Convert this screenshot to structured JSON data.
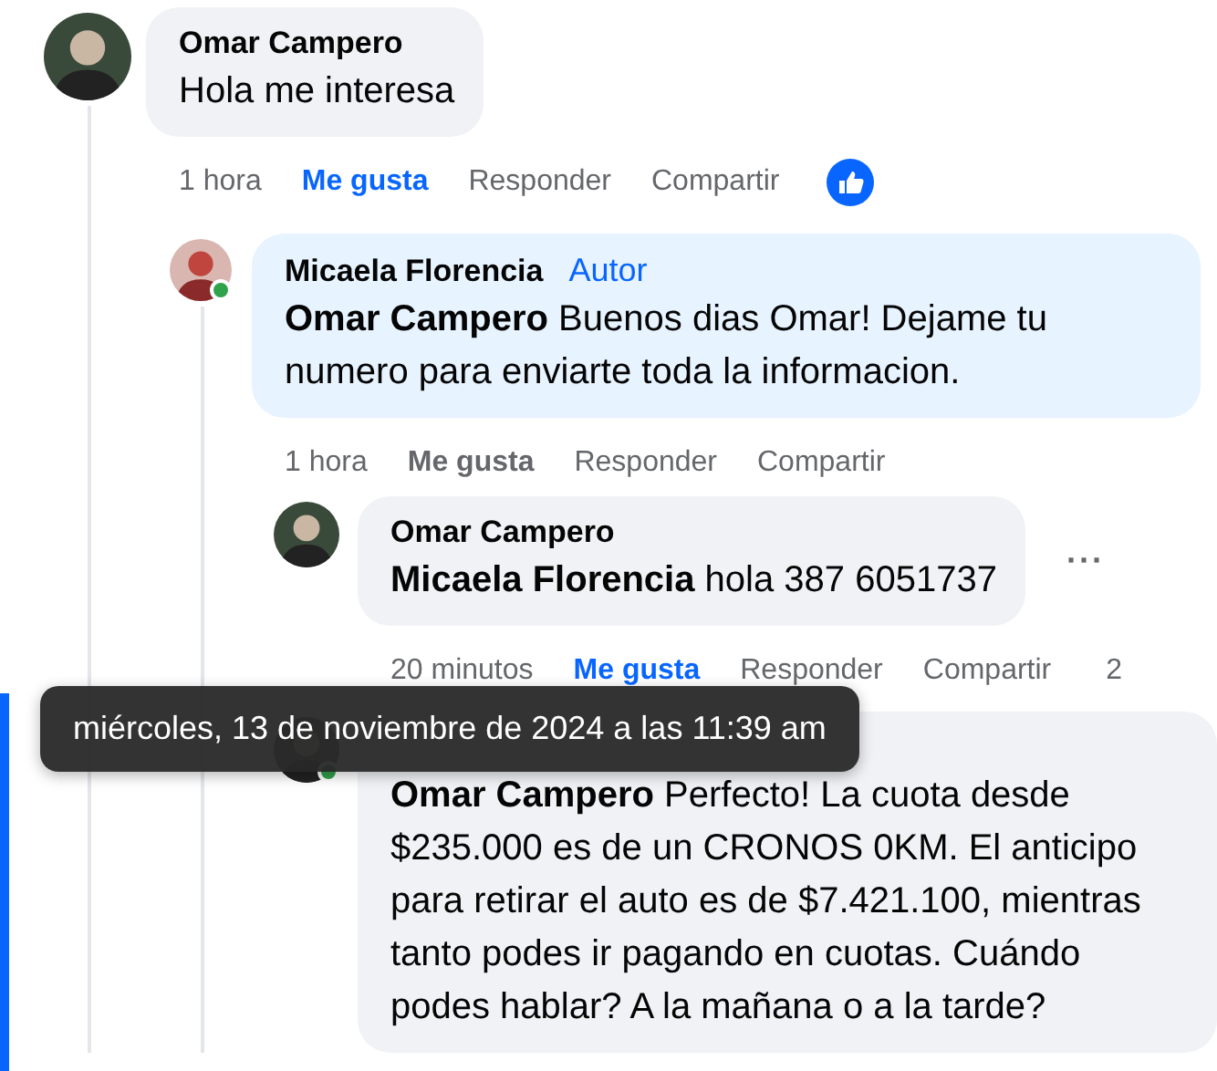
{
  "comments": [
    {
      "author": "Omar Campero",
      "online": false,
      "text": "Hola me interesa",
      "time": "1 hora",
      "like_label": "Me gusta",
      "liked": true,
      "reply_label": "Responder",
      "share_label": "Compartir",
      "reacted": true,
      "children": [
        {
          "author": "Micaela Florencia",
          "badge": "Autor",
          "online": true,
          "mention": "Omar Campero",
          "text": "Buenos dias Omar! Dejame tu numero para enviarte toda la informacion.",
          "time": "1 hora",
          "like_label": "Me gusta",
          "liked": false,
          "reply_label": "Responder",
          "share_label": "Compartir",
          "reacted": false,
          "children": [
            {
              "author": "Omar Campero",
              "online": false,
              "mention": "Micaela Florencia",
              "text": "hola 387 6051737",
              "time": "20 minutos",
              "like_label": "Me gusta",
              "liked": true,
              "reply_label": "Responder",
              "share_label": "Compartir",
              "reacted": false,
              "more_label": "···",
              "reaction_count": "2"
            },
            {
              "online": true,
              "mention": "Omar Campero",
              "text": "Perfecto! La cuota desde $235.000 es de un CRONOS 0KM. El anticipo para retirar el auto es de $7.421.100, mientras tanto podes ir pagando en cuotas. Cuándo podes hablar? A la mañana o a la tarde?"
            }
          ]
        }
      ]
    }
  ],
  "tooltip": "miércoles, 13 de noviembre de 2024 a las 11:39 am"
}
